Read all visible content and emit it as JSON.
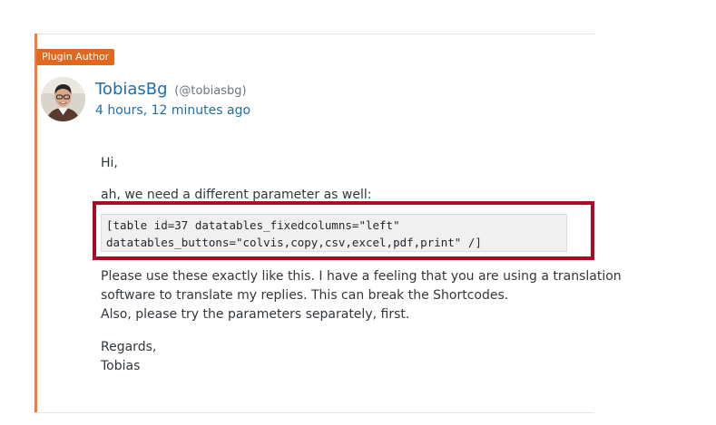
{
  "reply": {
    "badge": "Plugin Author",
    "author": {
      "name": "TobiasBg",
      "handle": "(@tobiasbg)",
      "avatar_icon": "user-avatar"
    },
    "timestamp": "4 hours, 12 minutes ago",
    "greeting": "Hi,",
    "intro": "ah, we need a different parameter as well:",
    "code_lines": [
      "[table id=37 datatables_fixedcolumns=\"left\"",
      "datatables_buttons=\"colvis,copy,csv,excel,pdf,print\" /]"
    ],
    "body_lines": [
      "Please use these exactly like this. I have a feeling that you are using a translation",
      "software to translate my replies. This can break the Shortcodes.",
      "Also, please try the parameters separately, first."
    ],
    "closing": "Regards,",
    "signature": "Tobias"
  },
  "colors": {
    "accent_orange": "#f17c3c",
    "badge_bg": "#e2681e",
    "link_blue": "#1e6ea7",
    "highlight_red": "#a80d24"
  }
}
